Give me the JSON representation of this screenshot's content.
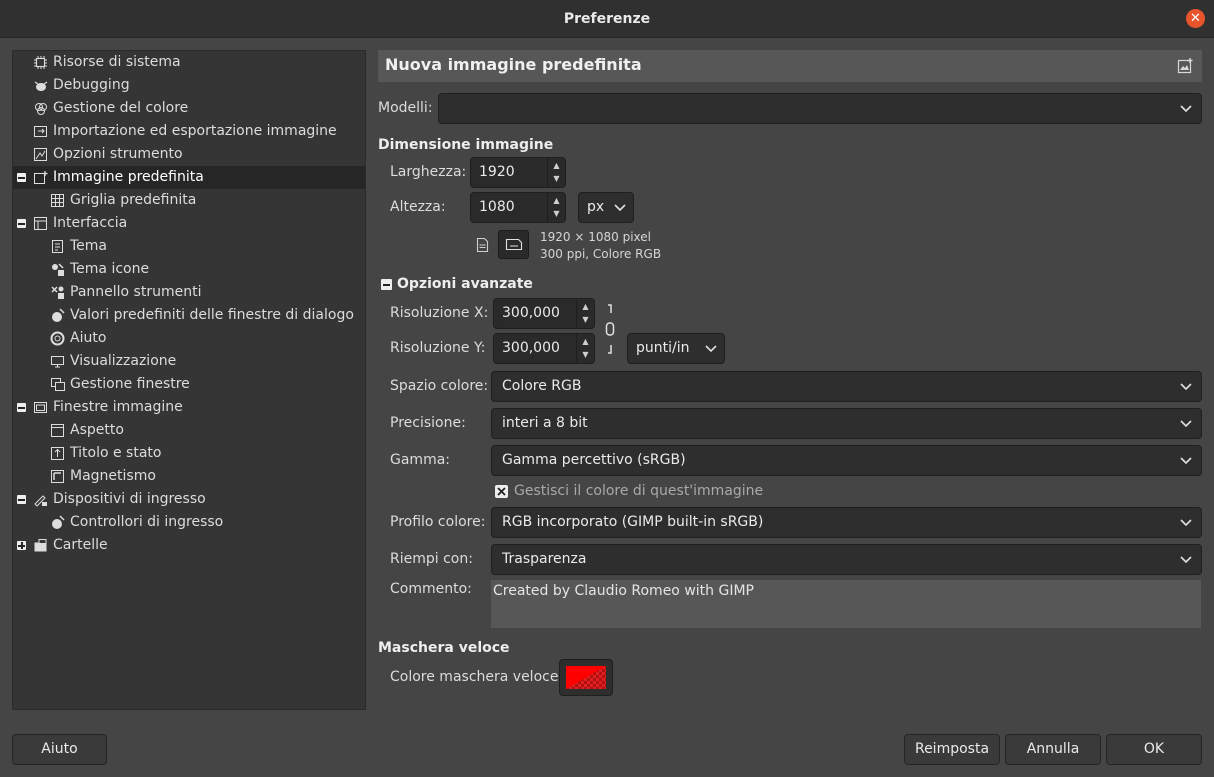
{
  "window": {
    "title": "Preferenze",
    "close_glyph": "✕"
  },
  "sidebar": {
    "items": [
      {
        "label": "Risorse di sistema",
        "icon": "chip-icon"
      },
      {
        "label": "Debugging",
        "icon": "bug-icon"
      },
      {
        "label": "Gestione del colore",
        "icon": "color-circles-icon"
      },
      {
        "label": "Importazione ed esportazione immagine",
        "icon": "import-export-icon"
      },
      {
        "label": "Opzioni strumento",
        "icon": "tool-options-icon"
      },
      {
        "label": "Immagine predefinita",
        "icon": "new-image-icon",
        "selected": true,
        "expander": "minus"
      },
      {
        "label": "Griglia predefinita",
        "icon": "grid-icon"
      },
      {
        "label": "Interfaccia",
        "icon": "interface-icon",
        "expander": "minus"
      },
      {
        "label": "Tema",
        "icon": "theme-icon"
      },
      {
        "label": "Tema icone",
        "icon": "icon-theme-icon"
      },
      {
        "label": "Pannello strumenti",
        "icon": "toolbox-icon"
      },
      {
        "label": "Valori predefiniti delle finestre di dialogo",
        "icon": "dialog-defaults-icon"
      },
      {
        "label": "Aiuto",
        "icon": "help-icon"
      },
      {
        "label": "Visualizzazione",
        "icon": "display-icon"
      },
      {
        "label": "Gestione finestre",
        "icon": "window-management-icon"
      },
      {
        "label": "Finestre immagine",
        "icon": "image-windows-icon",
        "expander": "minus"
      },
      {
        "label": "Aspetto",
        "icon": "appearance-icon"
      },
      {
        "label": "Titolo e stato",
        "icon": "title-status-icon"
      },
      {
        "label": "Magnetismo",
        "icon": "snapping-icon"
      },
      {
        "label": "Dispositivi di ingresso",
        "icon": "input-devices-icon",
        "expander": "minus"
      },
      {
        "label": "Controllori di ingresso",
        "icon": "input-controllers-icon"
      },
      {
        "label": "Cartelle",
        "icon": "folders-icon",
        "expander": "plus"
      }
    ]
  },
  "main": {
    "header_title": "Nuova immagine predefinita",
    "templates_label": "Modelli:",
    "templates_value": "",
    "image_size_heading": "Dimensione immagine",
    "width_label": "Larghezza:",
    "width_value": "1920",
    "height_label": "Altezza:",
    "height_value": "1080",
    "size_unit": "px",
    "size_info_line1": "1920 × 1080 pixel",
    "size_info_line2": "300 ppi, Colore RGB",
    "advanced_heading": "Opzioni avanzate",
    "xres_label": "Risoluzione X:",
    "xres_value": "300,000",
    "yres_label": "Risoluzione Y:",
    "yres_value": "300,000",
    "res_unit": "punti/in",
    "colorspace_label": "Spazio colore:",
    "colorspace_value": "Colore RGB",
    "precision_label": "Precisione:",
    "precision_value": "interi a 8 bit",
    "gamma_label": "Gamma:",
    "gamma_value": "Gamma percettivo (sRGB)",
    "color_manage_label": "Gestisci il colore di quest'immagine",
    "color_manage_checked": true,
    "profile_label": "Profilo colore:",
    "profile_value": "RGB incorporato (GIMP built-in sRGB)",
    "fill_label": "Riempi con:",
    "fill_value": "Trasparenza",
    "comment_label": "Commento:",
    "comment_value": "Created by Claudio Romeo with GIMP",
    "quickmask_heading": "Maschera veloce",
    "quickmask_color_label": "Colore maschera veloce:",
    "quickmask_color": "#ff0000"
  },
  "buttons": {
    "help": "Aiuto",
    "reset": "Reimposta",
    "cancel": "Annulla",
    "ok": "OK"
  }
}
